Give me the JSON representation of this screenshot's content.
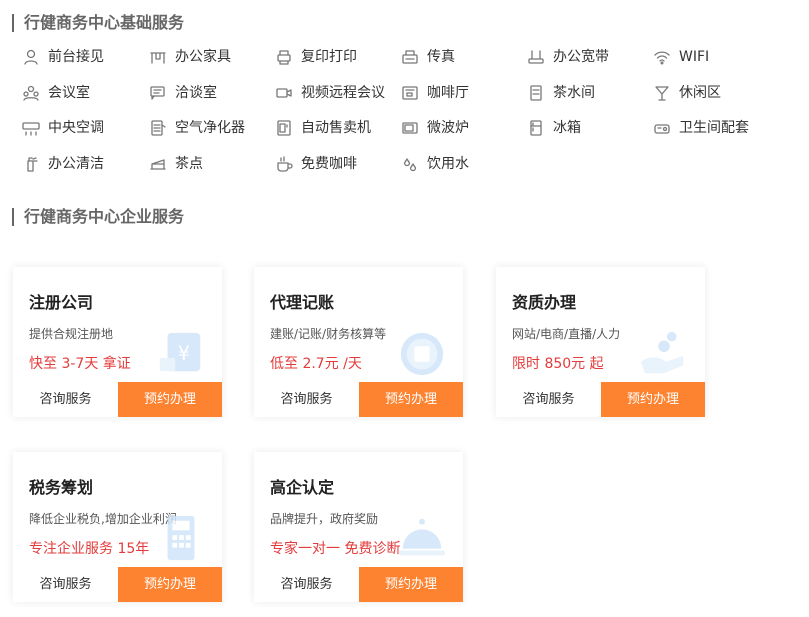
{
  "basic_section": {
    "title": "行健商务中心基础服务",
    "items": [
      {
        "label": "前台接见",
        "icon": "receptionist-icon"
      },
      {
        "label": "办公家具",
        "icon": "desk-icon"
      },
      {
        "label": "复印打印",
        "icon": "printer-icon"
      },
      {
        "label": "传真",
        "icon": "fax-icon"
      },
      {
        "label": "办公宽带",
        "icon": "router-icon"
      },
      {
        "label": "WIFI",
        "icon": "wifi-icon"
      },
      {
        "label": "会议室",
        "icon": "meeting-room-icon"
      },
      {
        "label": "洽谈室",
        "icon": "chat-icon"
      },
      {
        "label": "视频远程会议",
        "icon": "video-camera-icon"
      },
      {
        "label": "咖啡厅",
        "icon": "coffee-machine-icon"
      },
      {
        "label": "茶水间",
        "icon": "water-dispenser-icon"
      },
      {
        "label": "休闲区",
        "icon": "cocktail-icon"
      },
      {
        "label": "中央空调",
        "icon": "air-conditioner-icon"
      },
      {
        "label": "空气净化器",
        "icon": "air-purifier-icon"
      },
      {
        "label": "自动售卖机",
        "icon": "vending-machine-icon"
      },
      {
        "label": "微波炉",
        "icon": "microwave-icon"
      },
      {
        "label": "冰箱",
        "icon": "fridge-icon"
      },
      {
        "label": "卫生间配套",
        "icon": "toilet-icon"
      },
      {
        "label": "办公清洁",
        "icon": "spray-bottle-icon"
      },
      {
        "label": "茶点",
        "icon": "cake-icon"
      },
      {
        "label": "免费咖啡",
        "icon": "coffee-cup-icon"
      },
      {
        "label": "饮用水",
        "icon": "water-drops-icon"
      }
    ]
  },
  "enterprise_section": {
    "title": "行健商务中心企业服务",
    "cards": [
      {
        "title": "注册公司",
        "desc": "提供合规注册地",
        "price": "快至 3-7天 拿证",
        "art": "yuan-card-icon",
        "consult": "咨询服务",
        "book": "预约办理"
      },
      {
        "title": "代理记账",
        "desc": "建账/记账/财务核算等",
        "price": "低至 2.7元 /天",
        "art": "tax-badge-icon",
        "consult": "咨询服务",
        "book": "预约办理"
      },
      {
        "title": "资质办理",
        "desc": "网站/电商/直播/人力",
        "price": "限时 850元 起",
        "art": "hand-coins-icon",
        "consult": "咨询服务",
        "book": "预约办理"
      },
      {
        "title": "税务筹划",
        "desc": "降低企业税负,增加企业利润",
        "price": "专注企业服务 15年",
        "art": "calculator-icon",
        "consult": "咨询服务",
        "book": "预约办理"
      },
      {
        "title": "高企认定",
        "desc": "品牌提升，政府奖励",
        "price": "专家一对一 免费诊断",
        "art": "service-bell-icon",
        "consult": "咨询服务",
        "book": "预约办理"
      }
    ]
  },
  "colors": {
    "accent": "#fd8330",
    "price": "#e43b3b",
    "art": "#bcd9f7"
  }
}
